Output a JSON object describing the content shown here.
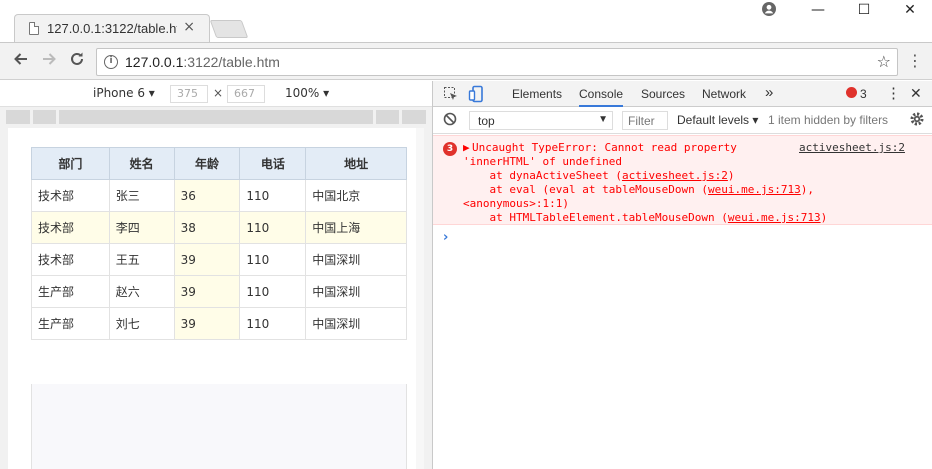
{
  "browser": {
    "tab_title": "127.0.0.1:3122/table.ht",
    "tab_close": "×",
    "url_host": "127.0.0.1",
    "url_rest": ":3122/table.htm",
    "window_minimize": "—",
    "window_maximize": "☐",
    "window_close": "✕"
  },
  "device_toolbar": {
    "device": "iPhone 6",
    "width": "375",
    "times": "×",
    "height": "667",
    "zoom": "100%"
  },
  "table": {
    "headers": [
      "部门",
      "姓名",
      "年龄",
      "电话",
      "地址"
    ],
    "rows": [
      [
        "技术部",
        "张三",
        "36",
        "110",
        "中国北京"
      ],
      [
        "技术部",
        "李四",
        "38",
        "110",
        "中国上海"
      ],
      [
        "技术部",
        "王五",
        "39",
        "110",
        "中国深圳"
      ],
      [
        "生产部",
        "赵六",
        "39",
        "110",
        "中国深圳"
      ],
      [
        "生产部",
        "刘七",
        "39",
        "110",
        "中国深圳"
      ]
    ]
  },
  "devtools": {
    "tabs": [
      "Elements",
      "Console",
      "Sources",
      "Network"
    ],
    "more": "»",
    "error_count": "3",
    "context": "top",
    "filter_placeholder": "Filter",
    "levels": "Default levels",
    "hidden": "1 item hidden by filters",
    "error": {
      "count": "3",
      "line1": "Uncaught TypeError: Cannot read property",
      "source": "activesheet.js:2",
      "line2": "'innerHTML' of undefined",
      "line3_pre": "    at dynaActiveSheet (",
      "line3_link": "activesheet.js:2",
      "line3_post": ")",
      "line4_pre": "    at eval (eval at tableMouseDown (",
      "line4_link": "weui.me.js:713",
      "line4_post": "),",
      "line5": "<anonymous>:1:1)",
      "line6_pre": "    at HTMLTableElement.tableMouseDown (",
      "line6_link": "weui.me.js:713",
      "line6_post": ")"
    },
    "prompt": "›"
  },
  "colors": {
    "header_bg": "#e3ecf6",
    "highlight_bg": "#fffde8",
    "error_text": "#ff0000",
    "console_accent": "#3879d9"
  }
}
